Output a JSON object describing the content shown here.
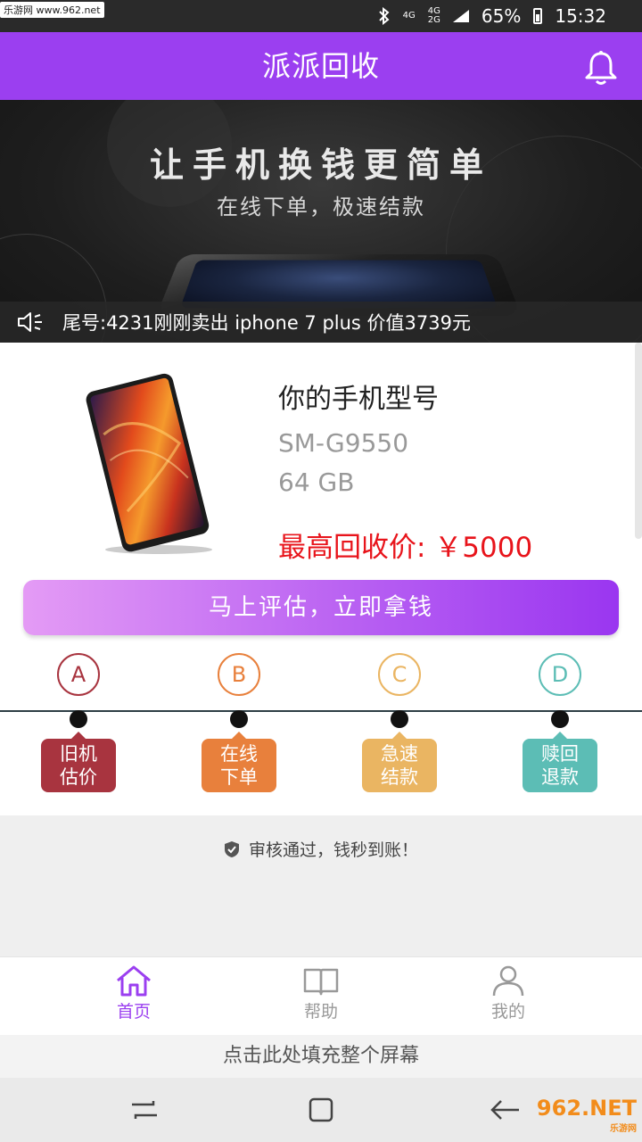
{
  "status_bar": {
    "watermark": "乐游网 www.962.net",
    "net1": "4G",
    "net2": "4G",
    "net2b": "2G",
    "battery": "65%",
    "time": "15:32"
  },
  "header": {
    "title": "派派回收"
  },
  "banner": {
    "headline": "让手机换钱更简单",
    "subline": "在线下单，极速结款",
    "ticker": "尾号:4231刚刚卖出 iphone 7 plus 价值3739元"
  },
  "product": {
    "title": "你的手机型号",
    "model": "SM-G9550",
    "capacity": "64 GB",
    "price": "最高回收价: ￥5000"
  },
  "cta_label": "马上评估，立即拿钱",
  "steps": [
    {
      "letter": "A",
      "label1": "旧机",
      "label2": "估价",
      "color": "#a8343f"
    },
    {
      "letter": "B",
      "label1": "在线",
      "label2": "下单",
      "color": "#e8803c"
    },
    {
      "letter": "C",
      "label1": "急速",
      "label2": "结款",
      "color": "#eab562"
    },
    {
      "letter": "D",
      "label1": "赎回",
      "label2": "退款",
      "color": "#5cbdb5"
    }
  ],
  "verify_text": "审核通过，钱秒到账！",
  "nav": [
    {
      "label": "首页",
      "icon": "home-icon",
      "active": true
    },
    {
      "label": "帮助",
      "icon": "book-icon",
      "active": false
    },
    {
      "label": "我的",
      "icon": "user-icon",
      "active": false
    }
  ],
  "fill_screen": "点击此处填充整个屏幕",
  "watermark_logo": {
    "main": "962.NET",
    "sub": "乐游网"
  },
  "colors": {
    "accent": "#9b3ff0",
    "price": "#e8141b"
  }
}
